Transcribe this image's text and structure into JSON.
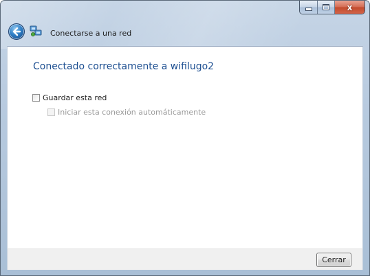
{
  "window": {
    "caption_buttons": {
      "minimize": "minimize-icon",
      "maximize": "maximize-icon",
      "close_glyph": "x"
    }
  },
  "nav": {
    "back_icon": "back-arrow-icon",
    "app_icon": "network-icon",
    "title": "Conectarse a una red"
  },
  "content": {
    "heading": "Conectado correctamente a wifilugo2",
    "options": [
      {
        "label": "Guardar esta red",
        "checked": false,
        "enabled": true
      },
      {
        "label": "Iniciar esta conexión automáticamente",
        "checked": false,
        "enabled": false
      }
    ]
  },
  "footer": {
    "close_label": "Cerrar"
  },
  "colors": {
    "heading": "#1d4f91",
    "disabled_text": "#9a9a9a",
    "frame": "#b7cadf"
  }
}
